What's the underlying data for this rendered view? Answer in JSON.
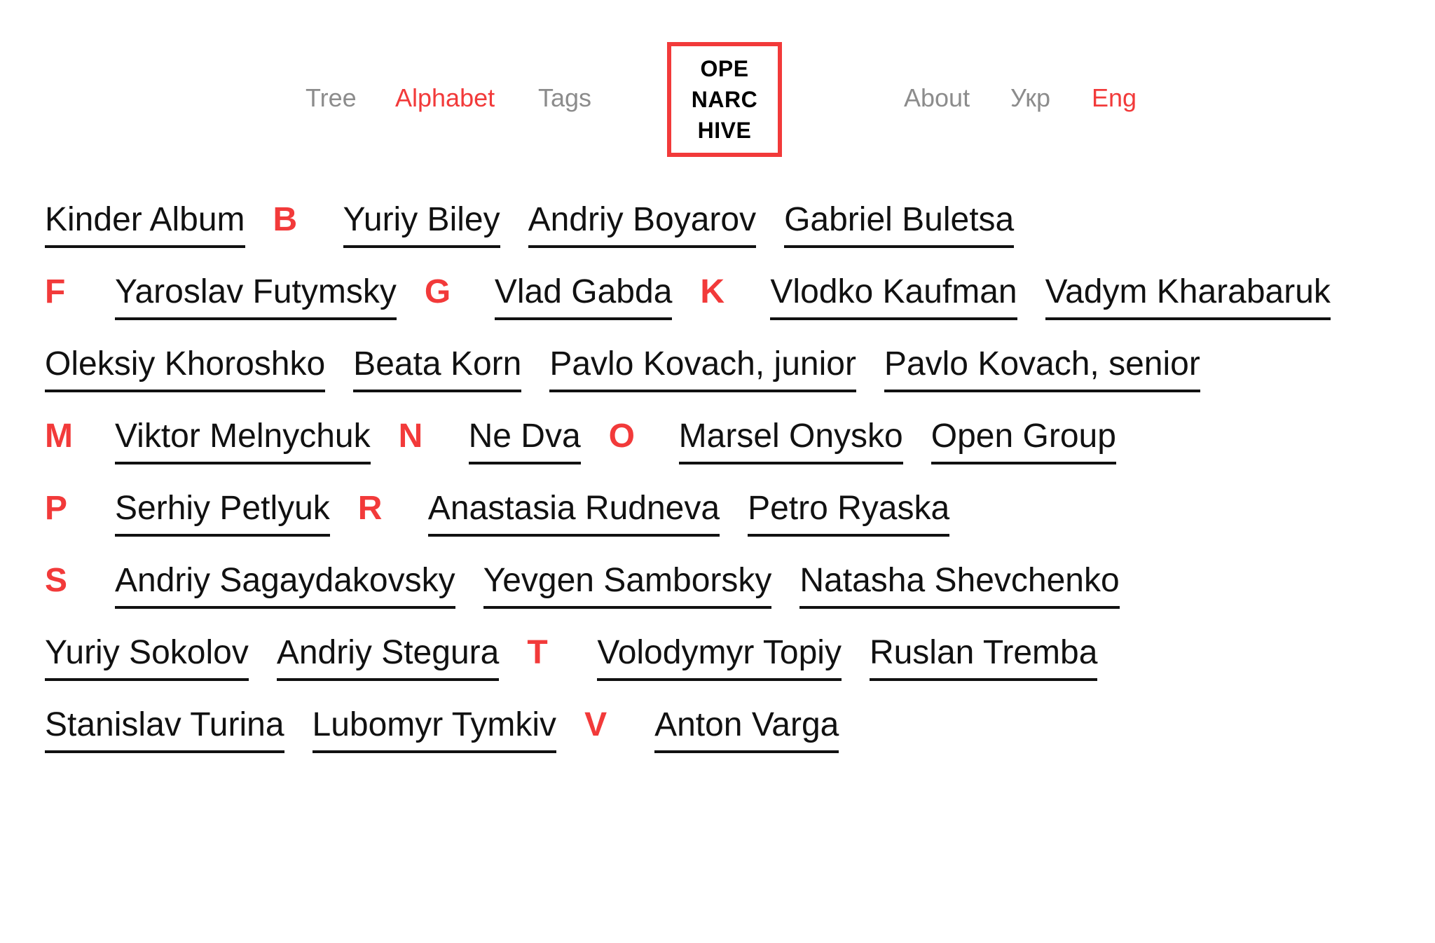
{
  "nav": {
    "left": [
      "Tree",
      "Alphabet",
      "Tags"
    ],
    "right": [
      "About",
      "Укр",
      "Eng"
    ],
    "active_left": "Alphabet",
    "active_right": "Eng"
  },
  "logo": {
    "lines": [
      "OPE",
      "NARC",
      "HIVE"
    ]
  },
  "accent_color": "#f23a3a",
  "rows": [
    [
      {
        "type": "entry",
        "text": "Kinder Album"
      },
      {
        "type": "letter",
        "text": "B"
      },
      {
        "type": "entry",
        "text": "Yuriy Biley"
      },
      {
        "type": "entry",
        "text": "Andriy Boyarov"
      },
      {
        "type": "entry",
        "text": "Gabriel Buletsa"
      }
    ],
    [
      {
        "type": "letter",
        "text": "F"
      },
      {
        "type": "entry",
        "text": "Yaroslav Futymsky"
      },
      {
        "type": "letter",
        "text": "G"
      },
      {
        "type": "entry",
        "text": "Vlad Gabda"
      },
      {
        "type": "letter",
        "text": "K"
      },
      {
        "type": "entry",
        "text": "Vlodko Kaufman"
      },
      {
        "type": "entry",
        "text": "Vadym Kharabaruk"
      }
    ],
    [
      {
        "type": "entry",
        "text": "Oleksiy Khoroshko"
      },
      {
        "type": "entry",
        "text": "Beata Korn"
      },
      {
        "type": "entry",
        "text": "Pavlo Kovach, junior"
      },
      {
        "type": "entry",
        "text": "Pavlo Kovach, senior"
      }
    ],
    [
      {
        "type": "letter",
        "text": "M"
      },
      {
        "type": "entry",
        "text": "Viktor Melnychuk"
      },
      {
        "type": "letter",
        "text": "N"
      },
      {
        "type": "entry",
        "text": "Ne Dva"
      },
      {
        "type": "letter",
        "text": "O"
      },
      {
        "type": "entry",
        "text": "Marsel Onysko"
      },
      {
        "type": "entry",
        "text": "Open Group"
      }
    ],
    [
      {
        "type": "letter",
        "text": "P"
      },
      {
        "type": "entry",
        "text": "Serhiy Petlyuk"
      },
      {
        "type": "letter",
        "text": "R"
      },
      {
        "type": "entry",
        "text": "Anastasia Rudneva"
      },
      {
        "type": "entry",
        "text": "Petro Ryaska"
      }
    ],
    [
      {
        "type": "letter",
        "text": "S"
      },
      {
        "type": "entry",
        "text": "Andriy Sagaydakovsky"
      },
      {
        "type": "entry",
        "text": "Yevgen Samborsky"
      },
      {
        "type": "entry",
        "text": "Natasha Shevchenko"
      }
    ],
    [
      {
        "type": "entry",
        "text": "Yuriy Sokolov"
      },
      {
        "type": "entry",
        "text": "Andriy Stegura"
      },
      {
        "type": "letter",
        "text": "T"
      },
      {
        "type": "entry",
        "text": "Volodymyr Topiy"
      },
      {
        "type": "entry",
        "text": "Ruslan Tremba"
      }
    ],
    [
      {
        "type": "entry",
        "text": "Stanislav Turina"
      },
      {
        "type": "entry",
        "text": "Lubomyr Tymkiv"
      },
      {
        "type": "letter",
        "text": "V"
      },
      {
        "type": "entry",
        "text": "Anton Varga"
      }
    ]
  ]
}
